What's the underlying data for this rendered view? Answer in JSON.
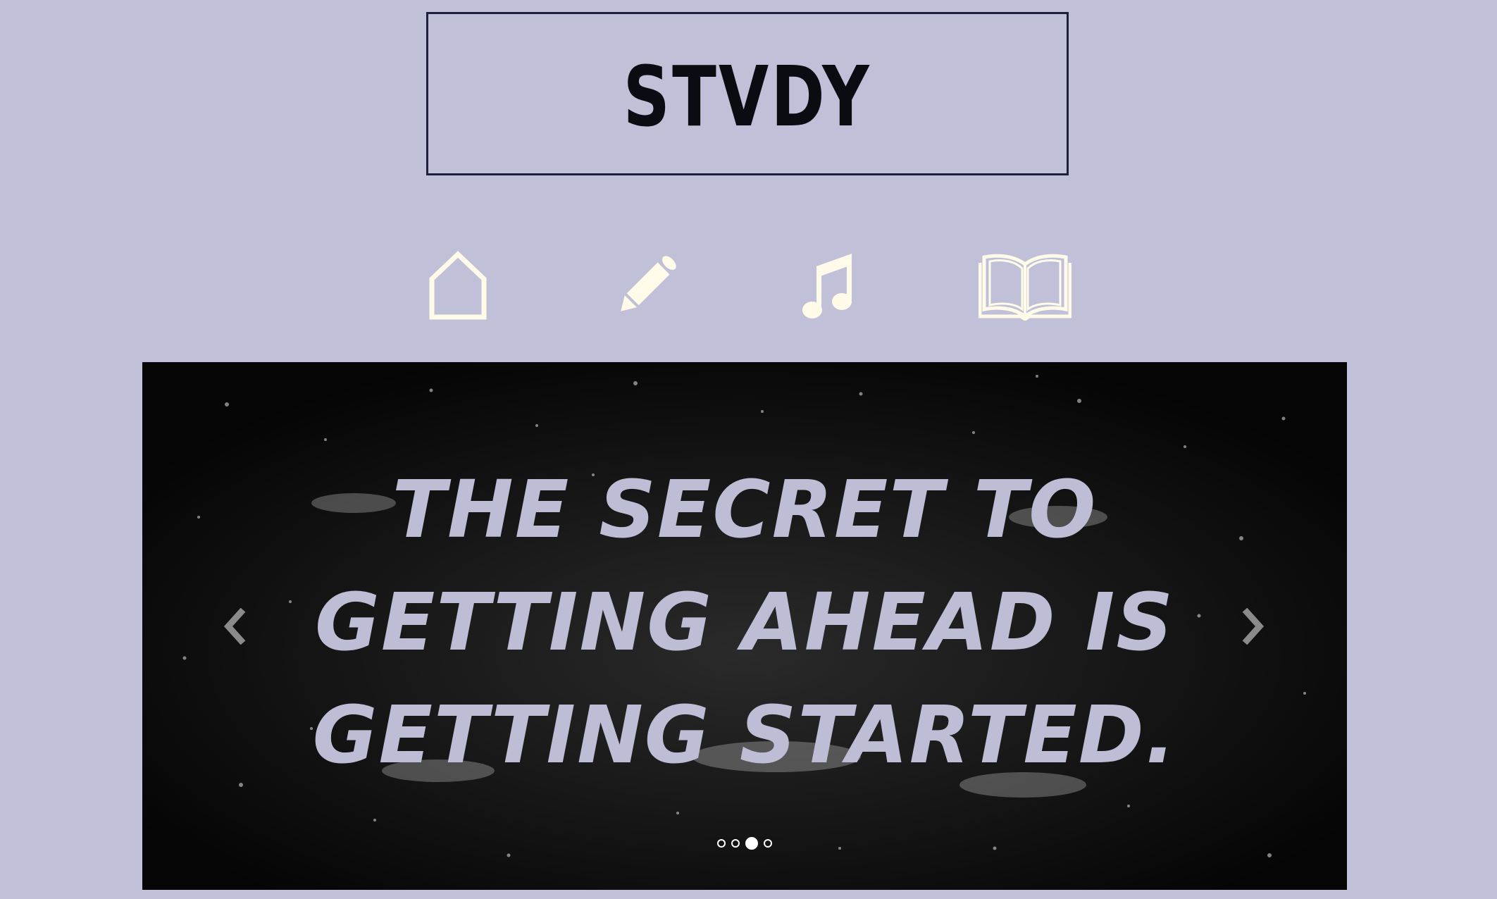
{
  "logo": {
    "text": "STVDY"
  },
  "nav": {
    "items": [
      {
        "name": "home",
        "icon": "home-icon"
      },
      {
        "name": "write",
        "icon": "pencil-icon"
      },
      {
        "name": "music",
        "icon": "music-note-icon"
      },
      {
        "name": "read",
        "icon": "open-book-icon"
      }
    ],
    "icon_color": "#fffbe8"
  },
  "carousel": {
    "quote_lines": [
      "The secret to",
      "getting ahead is",
      "getting started."
    ],
    "prev_icon": "chevron-left-icon",
    "next_icon": "chevron-right-icon",
    "slides_count": 4,
    "active_slide": 3,
    "quote_color": "#bdbed5"
  },
  "colors": {
    "background": "#c0c1d8",
    "logo_border": "#1d1f3d"
  }
}
